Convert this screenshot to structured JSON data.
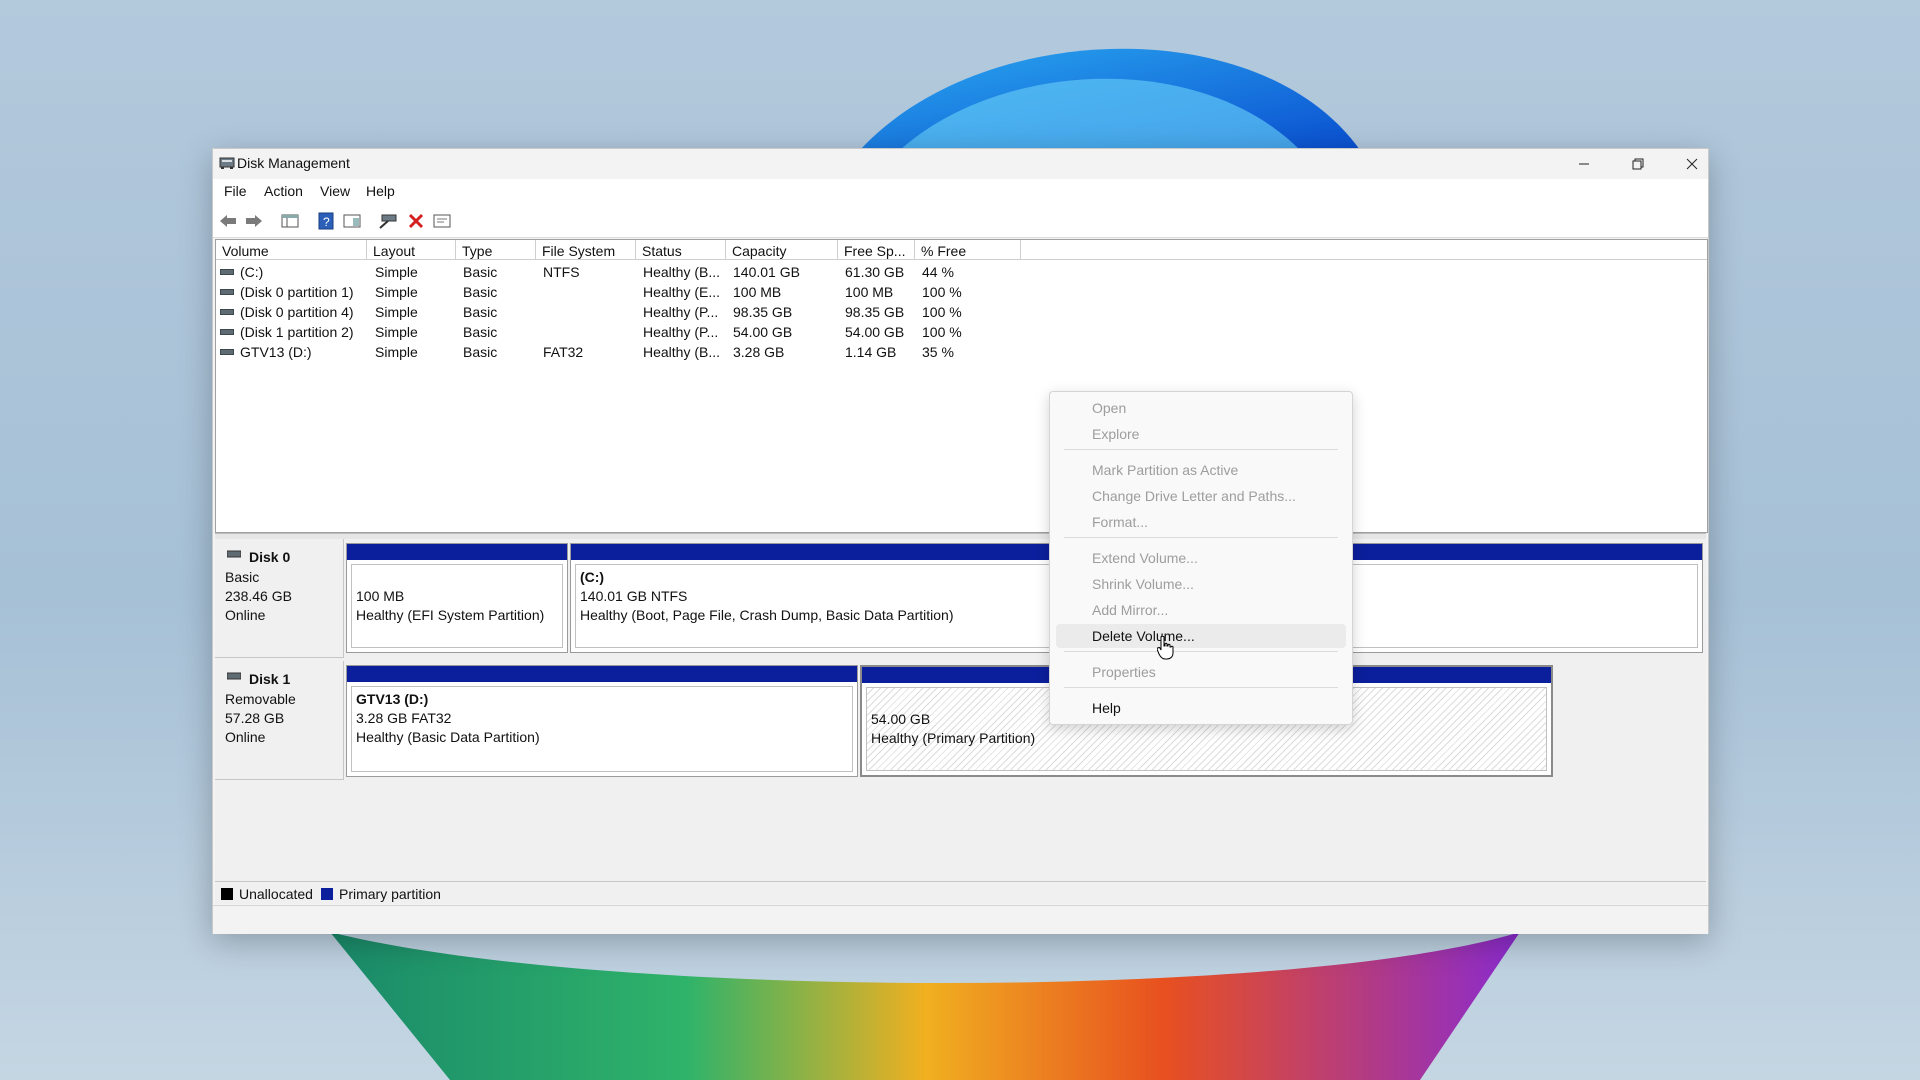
{
  "window": {
    "title": "Disk Management",
    "controls": {
      "minimize": "—",
      "maximize": "▢",
      "close": "✕"
    }
  },
  "menu": [
    "File",
    "Action",
    "View",
    "Help"
  ],
  "toolbar": {
    "icons": [
      "back-arrow-icon",
      "forward-arrow-icon",
      "console-tree-icon",
      "help-icon",
      "show-pane-icon",
      "connect-icon",
      "delete-icon",
      "properties-icon"
    ]
  },
  "volume_table": {
    "columns": [
      "Volume",
      "Layout",
      "Type",
      "File System",
      "Status",
      "Capacity",
      "Free Sp...",
      "% Free"
    ],
    "rows": [
      [
        "(C:)",
        "Simple",
        "Basic",
        "NTFS",
        "Healthy (B...",
        "140.01 GB",
        "61.30 GB",
        "44 %"
      ],
      [
        "(Disk 0 partition 1)",
        "Simple",
        "Basic",
        "",
        "Healthy (E...",
        "100 MB",
        "100 MB",
        "100 %"
      ],
      [
        "(Disk 0 partition 4)",
        "Simple",
        "Basic",
        "",
        "Healthy (P...",
        "98.35 GB",
        "98.35 GB",
        "100 %"
      ],
      [
        "(Disk 1 partition 2)",
        "Simple",
        "Basic",
        "",
        "Healthy (P...",
        "54.00 GB",
        "54.00 GB",
        "100 %"
      ],
      [
        "GTV13 (D:)",
        "Simple",
        "Basic",
        "FAT32",
        "Healthy (B...",
        "3.28 GB",
        "1.14 GB",
        "35 %"
      ]
    ]
  },
  "disks": [
    {
      "name": "Disk 0",
      "type": "Basic",
      "size": "238.46 GB",
      "state": "Online",
      "partitions": [
        {
          "title": "",
          "line1": "100 MB",
          "line2": "Healthy (EFI System Partition)"
        },
        {
          "title": "(C:)",
          "line1": "140.01 GB NTFS",
          "line2": "Healthy (Boot, Page File, Crash Dump, Basic Data Partition)"
        }
      ]
    },
    {
      "name": "Disk 1",
      "type": "Removable",
      "size": "57.28 GB",
      "state": "Online",
      "partitions": [
        {
          "title": "GTV13  (D:)",
          "line1": "3.28 GB FAT32",
          "line2": "Healthy (Basic Data Partition)"
        },
        {
          "title": "",
          "line1": "54.00 GB",
          "line2": "Healthy (Primary Partition)"
        }
      ]
    }
  ],
  "legend": [
    {
      "label": "Unallocated",
      "color": "#000000"
    },
    {
      "label": "Primary partition",
      "color": "#0b1f9c"
    }
  ],
  "context_menu": {
    "items": [
      {
        "label": "Open",
        "enabled": false
      },
      {
        "label": "Explore",
        "enabled": false
      },
      {
        "label": "Mark Partition as Active",
        "enabled": false
      },
      {
        "label": "Change Drive Letter and Paths...",
        "enabled": false
      },
      {
        "label": "Format...",
        "enabled": false
      },
      {
        "label": "Extend Volume...",
        "enabled": false
      },
      {
        "label": "Shrink Volume...",
        "enabled": false
      },
      {
        "label": "Add Mirror...",
        "enabled": false
      },
      {
        "label": "Delete Volume...",
        "enabled": true,
        "hover": true
      },
      {
        "label": "Properties",
        "enabled": false
      },
      {
        "label": "Help",
        "enabled": true
      }
    ]
  },
  "colors": {
    "primary_partition": "#0b1f9c",
    "accent_blue": "#1e6fe0"
  }
}
